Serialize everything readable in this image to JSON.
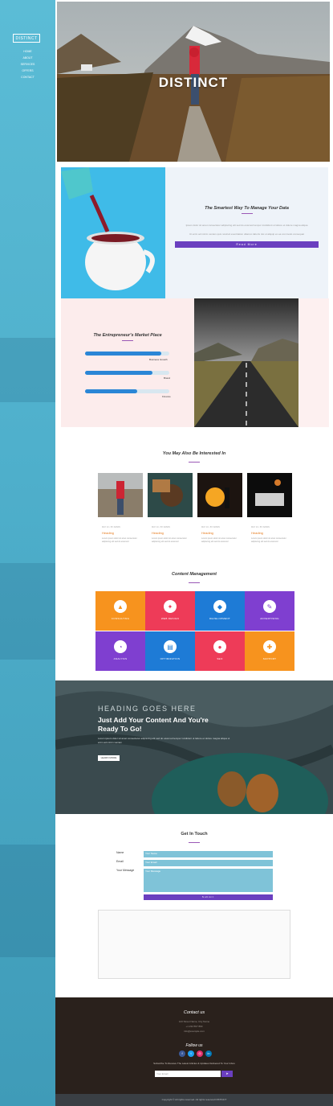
{
  "sidebar": {
    "logo": "DISTINCT",
    "nav": [
      "HOME",
      "ABOUT",
      "SERVICES",
      "OFFERS",
      "CONTACT"
    ]
  },
  "hero": {
    "title": "DISTINCT"
  },
  "smart": {
    "title": "The Smartest Way To Manage Your Data",
    "p1": "Ipsum dolor sit amet consectetur adipiscing elit sed do eiusmod tempor incididunt ut labore et dolore magna aliqua",
    "p2": "Ut enim ad minim veniam quis nostrud exercitation ullamco laboris nisi ut aliquip ex ea commodo consequat",
    "button": "Read More"
  },
  "market": {
    "title": "The Entrepreneur's Market Place",
    "bars": [
      {
        "label": "Business Growth",
        "value": 0.9
      },
      {
        "label": "Brand",
        "value": 0.8
      },
      {
        "label": "Finance",
        "value": 0.62
      }
    ]
  },
  "interest": {
    "title": "You May Also Be Interested In",
    "cards": [
      {
        "meta": "MAY 10 • BY ADMIN",
        "heading": "Heading",
        "desc": "Lorem ipsum dolor sit amet consectetur adipiscing elit sed do eiusmod"
      },
      {
        "meta": "MAY 10 • BY ADMIN",
        "heading": "Heading",
        "desc": "Lorem ipsum dolor sit amet consectetur adipiscing elit sed do eiusmod"
      },
      {
        "meta": "MAY 10 • BY ADMIN",
        "heading": "Heading",
        "desc": "Lorem ipsum dolor sit amet consectetur adipiscing elit sed do eiusmod"
      },
      {
        "meta": "MAY 10 • BY ADMIN",
        "heading": "Heading",
        "desc": "Lorem ipsum dolor sit amet consectetur adipiscing elit sed do eiusmod"
      }
    ]
  },
  "content_mgmt": {
    "title": "Content Management",
    "tiles": [
      {
        "label": "CONSULTING",
        "icon": "chart-icon",
        "color": "#f7931e"
      },
      {
        "label": "WEB DESIGN",
        "icon": "compass-icon",
        "color": "#ee3b58"
      },
      {
        "label": "DEVELOPMENT",
        "icon": "code-icon",
        "color": "#1e7bd6"
      },
      {
        "label": "ADVERTISING",
        "icon": "pen-icon",
        "color": "#7f3fd0"
      },
      {
        "label": "ANALYSIS",
        "icon": "pie-icon",
        "color": "#7f3fd0"
      },
      {
        "label": "OPTIMIZATION",
        "icon": "doc-icon",
        "color": "#1e7bd6"
      },
      {
        "label": "SEO",
        "icon": "bulb-icon",
        "color": "#ee3b58"
      },
      {
        "label": "SUPPORT",
        "icon": "support-icon",
        "color": "#f7931e"
      }
    ]
  },
  "banner": {
    "eyebrow": "HEADING GOES HERE",
    "title1": "Just Add Your Content And You're",
    "title2": "Ready To Go!",
    "desc": "Lorem ipsum dolor sit amet consectetur adipiscing elit sed do eiusmod tempor incididunt ut labore et dolore magna aliqua ut enim ad minim veniam",
    "button": "LEARN MORE"
  },
  "contact": {
    "title": "Get In Touch",
    "name_label": "Name",
    "name_value": "Your Name",
    "email_label": "Email",
    "email_value": "Your Email",
    "msg_label": "Your Message",
    "msg_value": "Your Message",
    "submit": "Submit"
  },
  "footer": {
    "contact_title": "Contact us",
    "lines": [
      "123 Street Name, City Name",
      "+1 234 567 890",
      "info@example.com"
    ],
    "follow_title": "Follow us",
    "newsletter_text": "Subscribe To Receive The Latest Articles & Updates Delivered To Your Inbox",
    "email_placeholder": "Your Email",
    "send": "➤",
    "copyright": "Copyright © All rights reserved. All rights reserved DISTINCT"
  }
}
